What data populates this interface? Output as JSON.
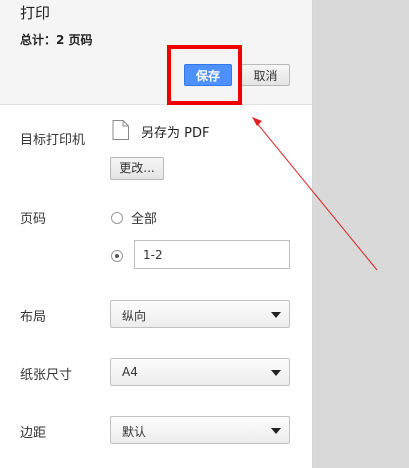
{
  "header": {
    "title": "打印",
    "summary": "总计：2 页码",
    "save_label": "保存",
    "cancel_label": "取消"
  },
  "destination": {
    "label": "目标打印机",
    "icon": "document-icon",
    "name": "另存为 PDF",
    "change_label": "更改..."
  },
  "pages": {
    "label": "页码",
    "all_label": "全部",
    "range_value": "1-2",
    "selected": "range"
  },
  "layout": {
    "label": "布局",
    "value": "纵向"
  },
  "paper_size": {
    "label": "纸张尺寸",
    "value": "A4"
  },
  "margins": {
    "label": "边距",
    "value": "默认"
  },
  "colors": {
    "primary_button": "#4d90fe",
    "highlight": "#ee0000",
    "annotation_arrow": "#e02020"
  }
}
